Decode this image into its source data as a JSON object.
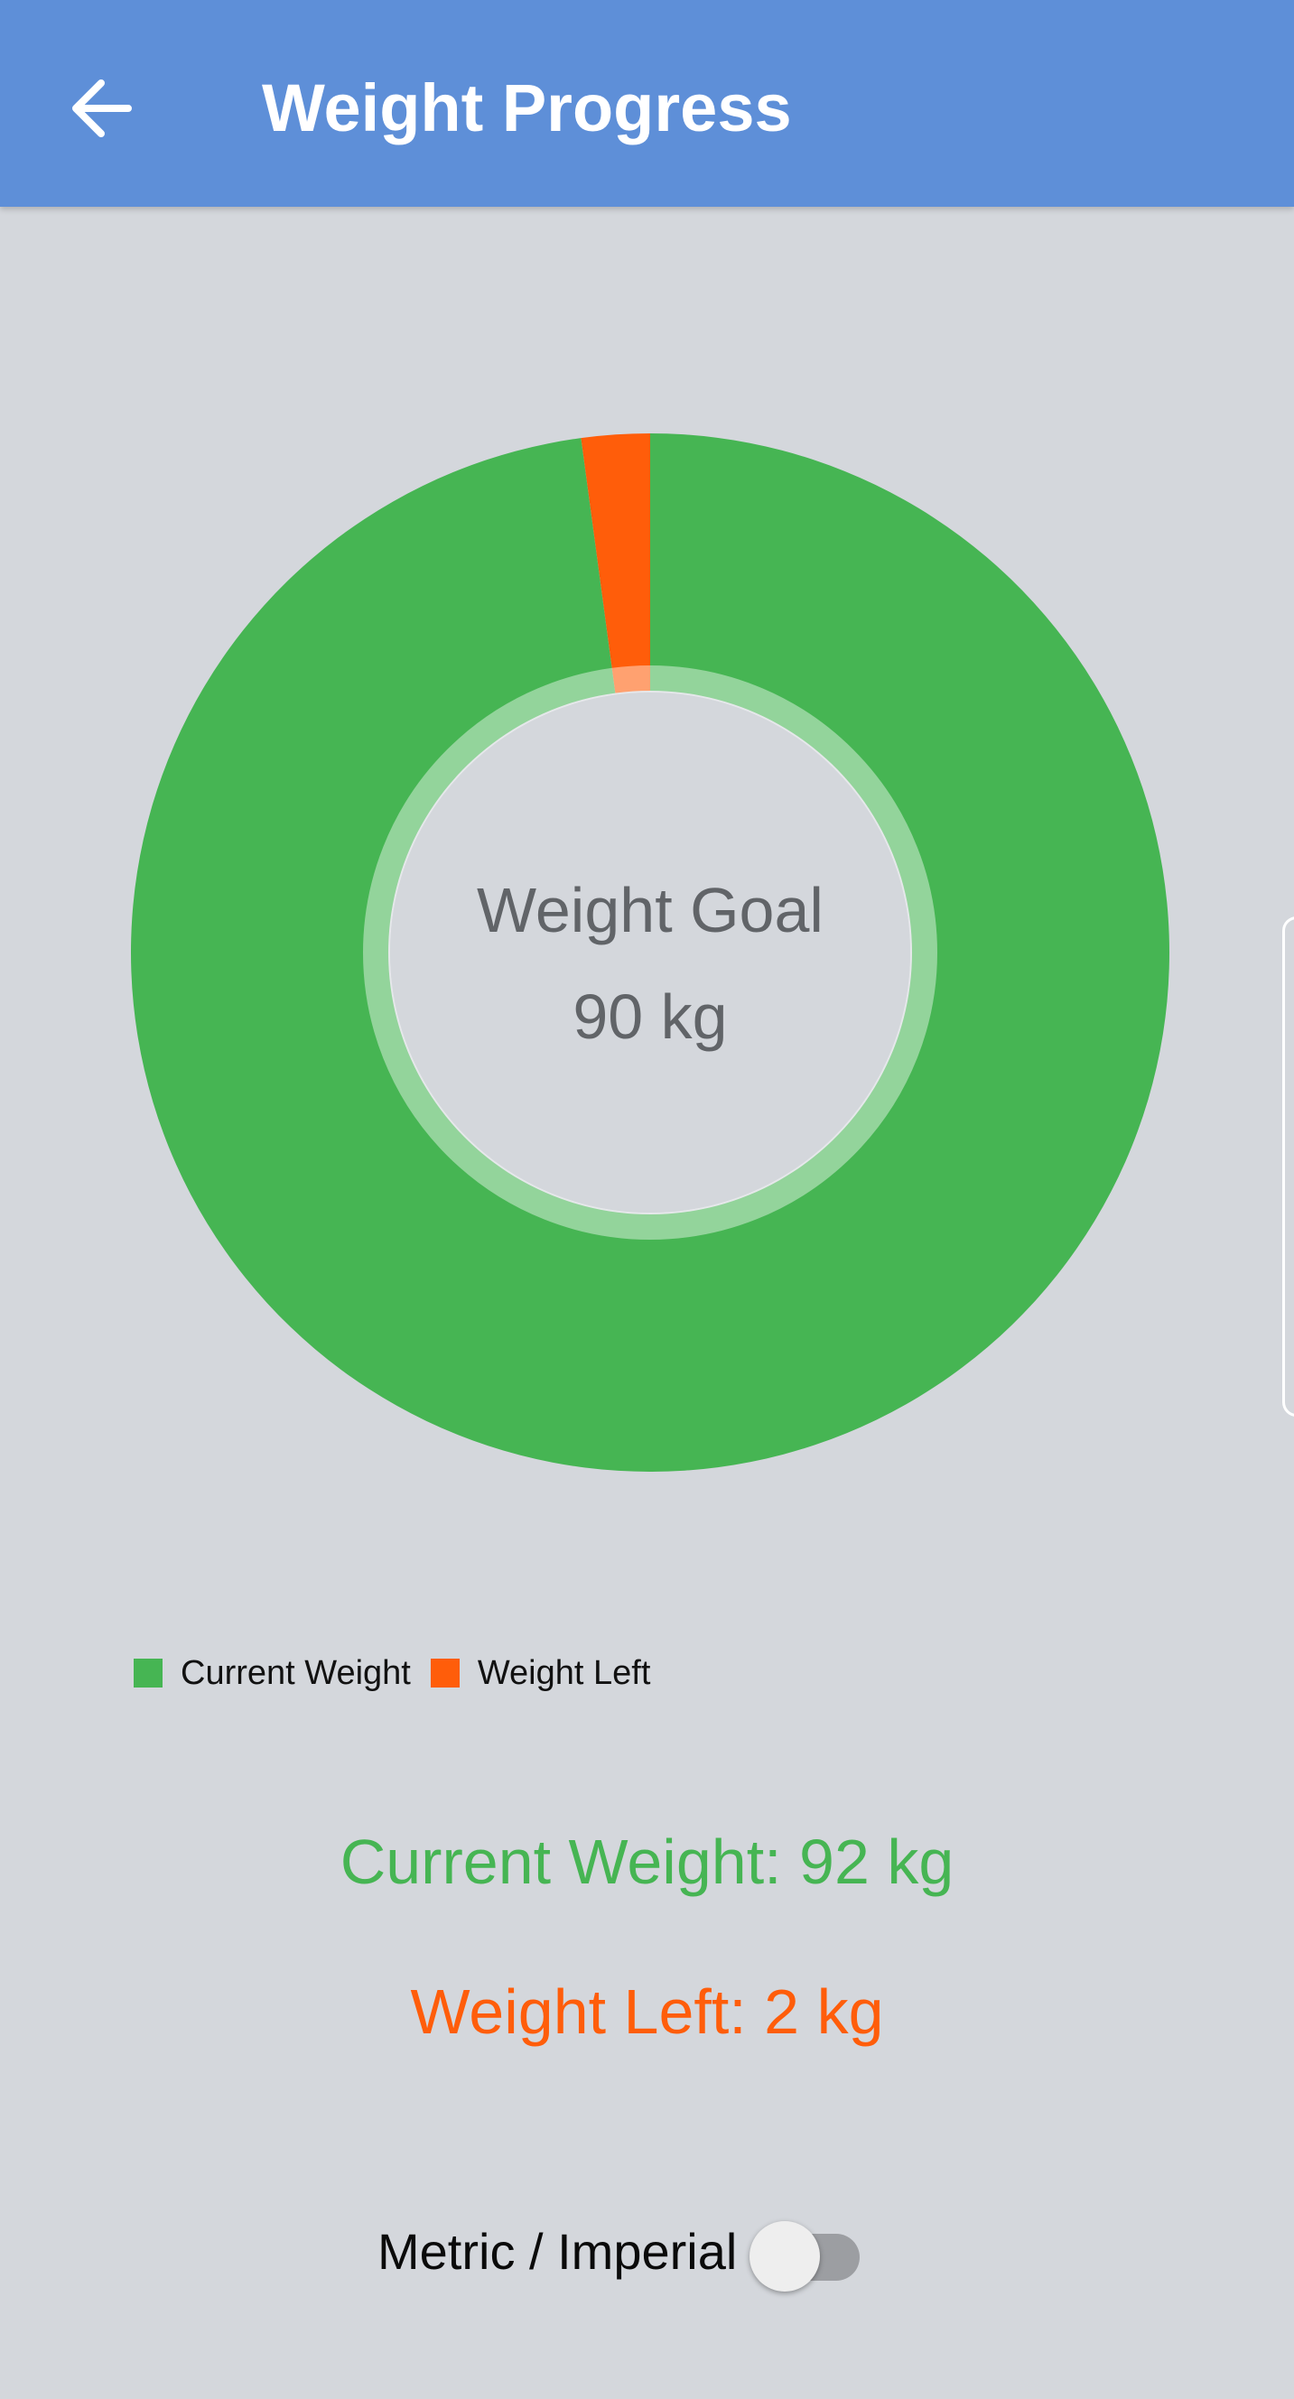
{
  "header": {
    "title": "Weight Progress",
    "back_icon": "arrow-back-icon"
  },
  "colors": {
    "app_bar": "#5e8fd8",
    "background": "#d4d7dc",
    "current_weight": "#46b553",
    "weight_left": "#ff5d0a",
    "center_text": "#616468"
  },
  "chart_data": {
    "type": "pie",
    "style": "donut",
    "slices": [
      {
        "label": "Current Weight",
        "value": 92,
        "color": "#46b553"
      },
      {
        "label": "Weight Left",
        "value": 2,
        "color": "#ff5d0a"
      }
    ],
    "center_title": "Weight Goal",
    "center_value": "90 kg",
    "legend": [
      "Current Weight",
      "Weight Left"
    ],
    "legend_position": "bottom-left"
  },
  "stats": {
    "current_weight": "Current Weight: 92 kg",
    "weight_left": "Weight Left: 2 kg"
  },
  "unit_toggle": {
    "label": "Metric / Imperial",
    "checked": false
  }
}
